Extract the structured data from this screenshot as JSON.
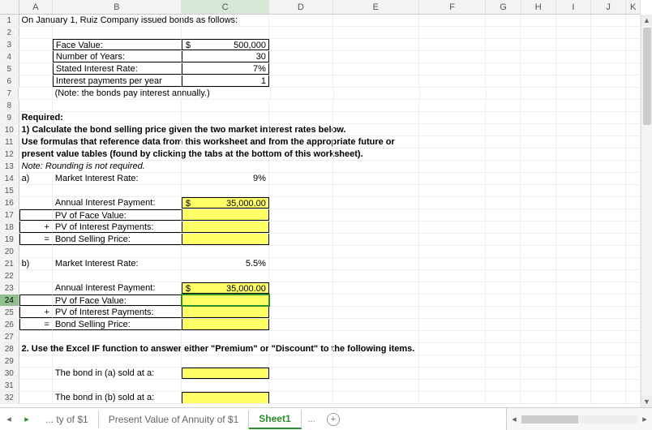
{
  "columns": [
    "A",
    "B",
    "C",
    "D",
    "E",
    "F",
    "G",
    "H",
    "I",
    "J",
    "K"
  ],
  "rows": {
    "r1": {
      "a": "On January 1,  Ruiz Company issued bonds as follows:"
    },
    "r3": {
      "b": "Face Value:",
      "c_sym": "$",
      "c": "500,000"
    },
    "r4": {
      "b": "Number of Years:",
      "c": "30"
    },
    "r5": {
      "b": "Stated Interest Rate:",
      "c": "7%"
    },
    "r6": {
      "b": "Interest payments per year",
      "c": "1"
    },
    "r7": {
      "b": "(Note: the bonds pay interest annually.)"
    },
    "r9": {
      "a": "Required:"
    },
    "r10": {
      "a": "1) Calculate the bond selling price given the two market interest rates below."
    },
    "r11": {
      "a": "Use formulas that reference data from this worksheet and from the appropriate future or"
    },
    "r12": {
      "a": "present value tables (found by clicking the tabs at the bottom of this worksheet)."
    },
    "r13": {
      "a": "Note:  Rounding is not required."
    },
    "r14": {
      "a": "a)",
      "b": "Market Interest Rate:",
      "c": "9%"
    },
    "r16": {
      "b": "Annual Interest Payment:",
      "c_sym": "$",
      "c": "35,000.00"
    },
    "r17": {
      "b": "PV of Face Value:"
    },
    "r18": {
      "a": "+",
      "b": "PV of Interest Payments:"
    },
    "r19": {
      "a": "=",
      "b": "Bond Selling Price:"
    },
    "r21": {
      "a": "b)",
      "b": "Market Interest Rate:",
      "c": "5.5%"
    },
    "r23": {
      "b": "Annual Interest Payment:",
      "c_sym": "$",
      "c": "35,000.00"
    },
    "r24": {
      "b": "PV of Face Value:"
    },
    "r25": {
      "a": "+",
      "b": "PV of Interest Payments:"
    },
    "r26": {
      "a": "=",
      "b": "Bond Selling Price:"
    },
    "r28": {
      "a": "2. Use the Excel IF function to answer either \"Premium\" or \"Discount\" to the following items."
    },
    "r30": {
      "b": "The bond in (a) sold at a:"
    },
    "r32": {
      "b": "The bond in (b) sold at a:"
    }
  },
  "tabs": {
    "t1": "... ty of $1",
    "t2": "Present Value of Annuity of $1",
    "t3": "Sheet1",
    "more": "..."
  },
  "icons": {
    "plus": "+",
    "left": "◄",
    "right": "►",
    "up": "▲",
    "down": "▼",
    "leftsm": "◂",
    "rightsm": "▸"
  }
}
